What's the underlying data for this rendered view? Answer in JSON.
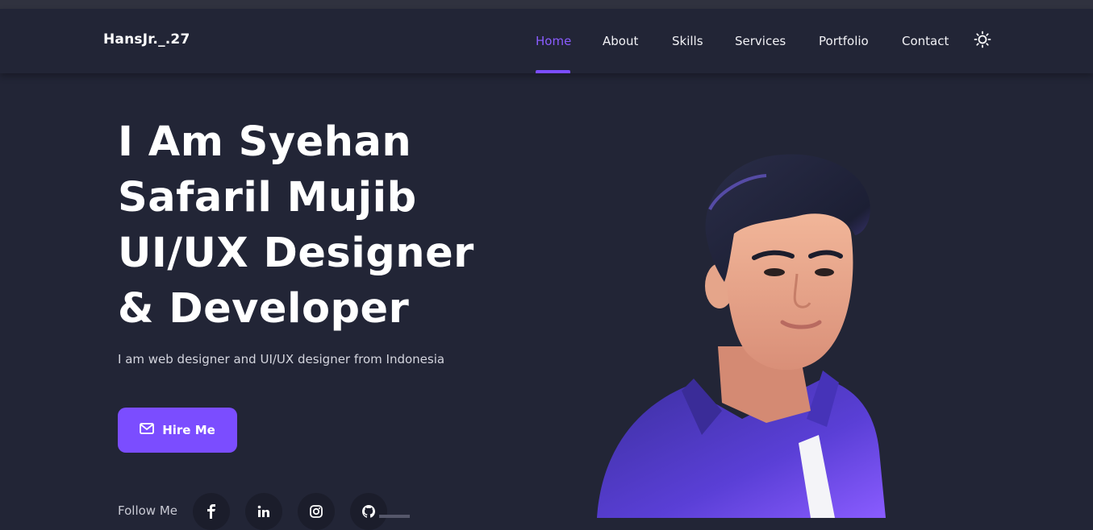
{
  "brand": "HansJr._.27",
  "nav": {
    "items": [
      {
        "label": "Home",
        "active": true
      },
      {
        "label": "About",
        "active": false
      },
      {
        "label": "Skills",
        "active": false
      },
      {
        "label": "Services",
        "active": false
      },
      {
        "label": "Portfolio",
        "active": false
      },
      {
        "label": "Contact",
        "active": false
      }
    ],
    "theme_icon": "sun-icon"
  },
  "hero": {
    "title_lines": [
      "I Am Syehan",
      "Safaril Mujib",
      "UI/UX Designer",
      "& Developer"
    ],
    "subtitle": "I am web designer and UI/UX designer from Indonesia",
    "cta_label": "Hire Me",
    "cta_icon": "mail-icon"
  },
  "follow": {
    "label": "Follow Me",
    "socials": [
      "facebook-icon",
      "linkedin-icon",
      "instagram-icon",
      "github-icon"
    ]
  },
  "colors": {
    "background": "#222536",
    "accent": "#7b4dff",
    "text": "#ffffff"
  }
}
